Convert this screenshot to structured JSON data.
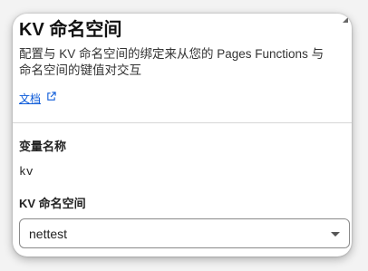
{
  "dialog": {
    "title": "KV 命名空间",
    "description": "配置与 KV 命名空间的绑定来从您的 Pages Functions 与命名空间的键值对交互",
    "docs_link": "文档"
  },
  "form": {
    "variable_name_label": "变量名称",
    "variable_name_value": "kv",
    "namespace_label": "KV 命名空间",
    "namespace_selected": "nettest"
  },
  "colors": {
    "link": "#0b5ad9",
    "border": "#8a8a8a"
  },
  "icons": {
    "external_link": "external-link-icon",
    "dropdown": "caret-down-icon"
  }
}
